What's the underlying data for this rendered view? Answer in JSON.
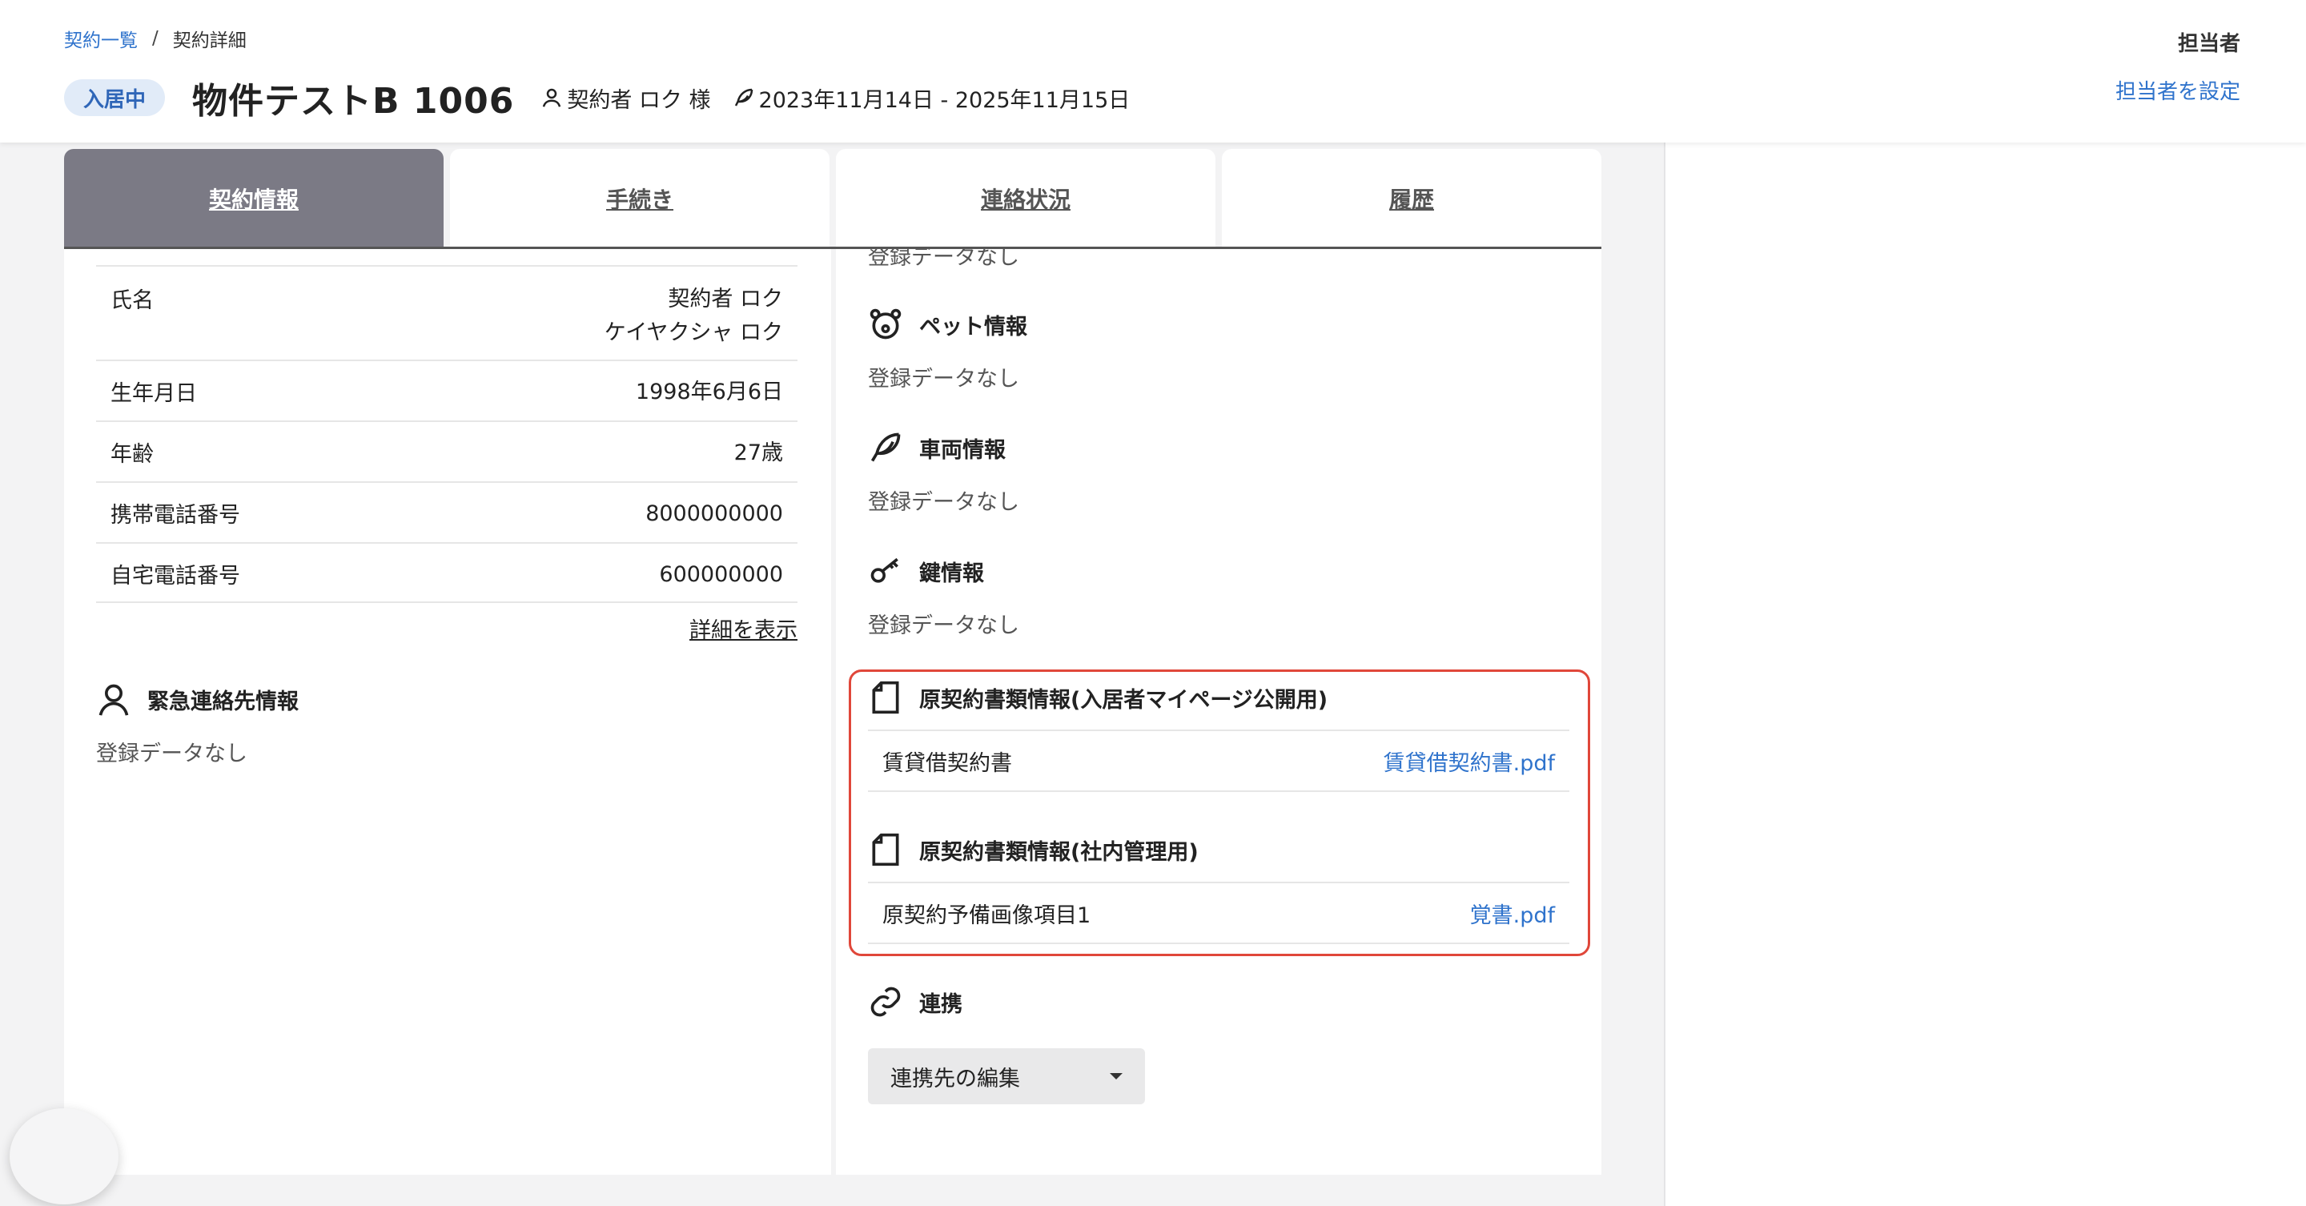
{
  "breadcrumb": {
    "list": "契約一覧",
    "separator": "/",
    "current": "契約詳細"
  },
  "header": {
    "status": "入居中",
    "title": "物件テストB 1006",
    "contractor": "契約者 ロク 様",
    "period": "2023年11月14日 - 2025年11月15日"
  },
  "assignee": {
    "label": "担当者",
    "set_link": "担当者を設定"
  },
  "tabs": [
    {
      "label": "契約情報",
      "active": true
    },
    {
      "label": "手続き",
      "active": false
    },
    {
      "label": "連絡状況",
      "active": false
    },
    {
      "label": "履歴",
      "active": false
    }
  ],
  "contractor_info": {
    "rows": [
      {
        "label": "氏名",
        "value": "契約者 ロク",
        "value2": "ケイヤクシャ ロク"
      },
      {
        "label": "生年月日",
        "value": "1998年6月6日"
      },
      {
        "label": "年齢",
        "value": "27歳"
      },
      {
        "label": "携帯電話番号",
        "value": "8000000000"
      },
      {
        "label": "自宅電話番号",
        "value": "600000000"
      }
    ],
    "detail_link": "詳細を表示"
  },
  "emergency": {
    "title": "緊急連絡先情報",
    "empty": "登録データなし"
  },
  "right_sections": {
    "top_cut_empty": "登録データなし",
    "pet": {
      "title": "ペット情報",
      "empty": "登録データなし"
    },
    "vehicle": {
      "title": "車両情報",
      "empty": "登録データなし"
    },
    "key": {
      "title": "鍵情報",
      "empty": "登録データなし"
    },
    "docs_resident": {
      "title": "原契約書類情報(入居者マイページ公開用)",
      "item_label": "賃貸借契約書",
      "file": "賃貸借契約書.pdf"
    },
    "docs_internal": {
      "title": "原契約書類情報(社内管理用)",
      "item_label": "原契約予備画像項目1",
      "file": "覚書.pdf"
    },
    "integration": {
      "title": "連携",
      "dropdown": "連携先の編集"
    }
  },
  "colors": {
    "link": "#2f73cc",
    "active_tab": "#7b7a85",
    "status_badge_bg": "#e1ebf8",
    "highlight_border": "#e0473a"
  }
}
